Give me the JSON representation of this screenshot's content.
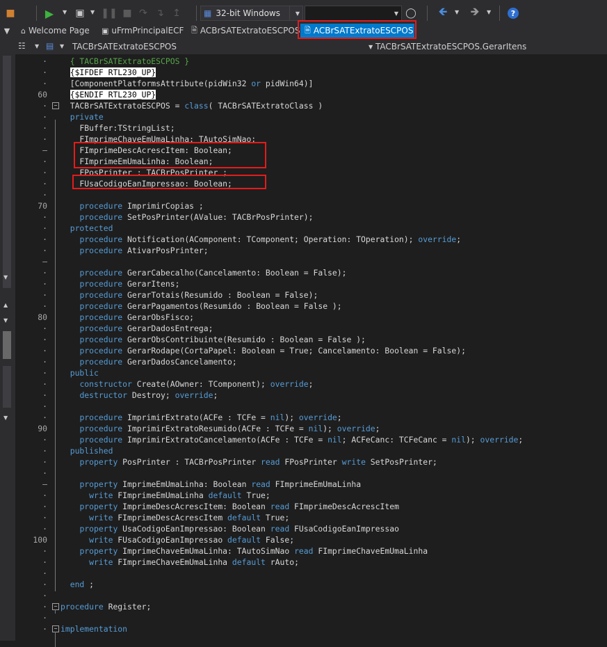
{
  "toolbar": {
    "platform_label": "32-bit Windows",
    "help_label": "?"
  },
  "tabs": [
    {
      "label": "Welcome Page"
    },
    {
      "label": "uFrmPrincipalECF"
    },
    {
      "label": "ACBrSATExtratoESCPOS"
    },
    {
      "label": "ACBrSATExtratoESCPOS"
    }
  ],
  "navbar": {
    "class_combo": "TACBrSATExtratoESCPOS",
    "method_combo": "TACBrSATExtratoESCPOS.GerarItens"
  },
  "editor": {
    "lines": [
      {
        "n": "·",
        "fold": "",
        "tokens": [
          {
            "t": "  { TACBrSATExtratoESCPOS }",
            "c": "cm"
          }
        ]
      },
      {
        "n": "·",
        "fold": "",
        "tokens": [
          {
            "t": "  "
          },
          {
            "t": "{$IFDEF RTL230_UP}",
            "c": "dir"
          }
        ]
      },
      {
        "n": "·",
        "fold": "",
        "tokens": [
          {
            "t": "  [ComponentPlatformsAttribute(pidWin32 "
          },
          {
            "t": "or",
            "c": "kw"
          },
          {
            "t": " pidWin64)]"
          }
        ]
      },
      {
        "n": "60",
        "fold": "",
        "tokens": [
          {
            "t": "  "
          },
          {
            "t": "{$ENDIF RTL230_UP}",
            "c": "dir"
          }
        ]
      },
      {
        "n": "·",
        "fold": "box",
        "tokens": [
          {
            "t": "  TACBrSATExtratoESCPOS = "
          },
          {
            "t": "class",
            "c": "kw"
          },
          {
            "t": "( TACBrSATExtratoClass )"
          }
        ]
      },
      {
        "n": "·",
        "fold": "",
        "tokens": [
          {
            "t": "  "
          },
          {
            "t": "private",
            "c": "kw"
          }
        ]
      },
      {
        "n": "·",
        "fold": "",
        "tokens": [
          {
            "t": "    FBuffer:TStringList;"
          }
        ]
      },
      {
        "n": "·",
        "fold": "",
        "tokens": [
          {
            "t": "    FImprimeChaveEmUmaLinha: TAutoSimNao;"
          }
        ]
      },
      {
        "n": "–",
        "fold": "",
        "tokens": [
          {
            "t": "    FImprimeDescAcrescItem: Boolean;"
          }
        ]
      },
      {
        "n": "·",
        "fold": "",
        "tokens": [
          {
            "t": "    FImprimeEmUmaLinha: Boolean;"
          }
        ]
      },
      {
        "n": "·",
        "fold": "",
        "tokens": [
          {
            "t": "    FPosPrinter : TACBrPosPrinter ;"
          }
        ]
      },
      {
        "n": "·",
        "fold": "",
        "tokens": [
          {
            "t": "    FUsaCodigoEanImpressao: Boolean;"
          }
        ]
      },
      {
        "n": "·",
        "fold": "",
        "tokens": []
      },
      {
        "n": "70",
        "fold": "",
        "tokens": [
          {
            "t": "    "
          },
          {
            "t": "procedure",
            "c": "kw"
          },
          {
            "t": " ImprimirCopias ;"
          }
        ]
      },
      {
        "n": "·",
        "fold": "",
        "tokens": [
          {
            "t": "    "
          },
          {
            "t": "procedure",
            "c": "kw"
          },
          {
            "t": " SetPosPrinter(AValue: TACBrPosPrinter);"
          }
        ]
      },
      {
        "n": "·",
        "fold": "",
        "tokens": [
          {
            "t": "  "
          },
          {
            "t": "protected",
            "c": "kw"
          }
        ]
      },
      {
        "n": "·",
        "fold": "",
        "tokens": [
          {
            "t": "    "
          },
          {
            "t": "procedure",
            "c": "kw"
          },
          {
            "t": " Notification(AComponent: TComponent; Operation: TOperation); "
          },
          {
            "t": "override",
            "c": "kw"
          },
          {
            "t": ";"
          }
        ]
      },
      {
        "n": "·",
        "fold": "",
        "tokens": [
          {
            "t": "    "
          },
          {
            "t": "procedure",
            "c": "kw"
          },
          {
            "t": " AtivarPosPrinter;"
          }
        ]
      },
      {
        "n": "–",
        "fold": "",
        "tokens": []
      },
      {
        "n": "·",
        "fold": "",
        "tokens": [
          {
            "t": "    "
          },
          {
            "t": "procedure",
            "c": "kw"
          },
          {
            "t": " GerarCabecalho(Cancelamento: Boolean = False);"
          }
        ]
      },
      {
        "n": "·",
        "fold": "",
        "tokens": [
          {
            "t": "    "
          },
          {
            "t": "procedure",
            "c": "kw"
          },
          {
            "t": " GerarItens;"
          }
        ]
      },
      {
        "n": "·",
        "fold": "",
        "tokens": [
          {
            "t": "    "
          },
          {
            "t": "procedure",
            "c": "kw"
          },
          {
            "t": " GerarTotais(Resumido : Boolean = False);"
          }
        ]
      },
      {
        "n": "·",
        "fold": "",
        "tokens": [
          {
            "t": "    "
          },
          {
            "t": "procedure",
            "c": "kw"
          },
          {
            "t": " GerarPagamentos(Resumido : Boolean = False );"
          }
        ]
      },
      {
        "n": "80",
        "fold": "",
        "tokens": [
          {
            "t": "    "
          },
          {
            "t": "procedure",
            "c": "kw"
          },
          {
            "t": " GerarObsFisco;"
          }
        ]
      },
      {
        "n": "·",
        "fold": "",
        "tokens": [
          {
            "t": "    "
          },
          {
            "t": "procedure",
            "c": "kw"
          },
          {
            "t": " GerarDadosEntrega;"
          }
        ]
      },
      {
        "n": "·",
        "fold": "",
        "tokens": [
          {
            "t": "    "
          },
          {
            "t": "procedure",
            "c": "kw"
          },
          {
            "t": " GerarObsContribuinte(Resumido : Boolean = False );"
          }
        ]
      },
      {
        "n": "·",
        "fold": "",
        "tokens": [
          {
            "t": "    "
          },
          {
            "t": "procedure",
            "c": "kw"
          },
          {
            "t": " GerarRodape(CortaPapel: Boolean = True; Cancelamento: Boolean = False);"
          }
        ]
      },
      {
        "n": "·",
        "fold": "",
        "tokens": [
          {
            "t": "    "
          },
          {
            "t": "procedure",
            "c": "kw"
          },
          {
            "t": " GerarDadosCancelamento;"
          }
        ]
      },
      {
        "n": "·",
        "fold": "",
        "tokens": [
          {
            "t": "  "
          },
          {
            "t": "public",
            "c": "kw"
          }
        ]
      },
      {
        "n": "·",
        "fold": "",
        "tokens": [
          {
            "t": "    "
          },
          {
            "t": "constructor",
            "c": "kw"
          },
          {
            "t": " Create(AOwner: TComponent); "
          },
          {
            "t": "override",
            "c": "kw"
          },
          {
            "t": ";"
          }
        ]
      },
      {
        "n": "·",
        "fold": "",
        "tokens": [
          {
            "t": "    "
          },
          {
            "t": "destructor",
            "c": "kw"
          },
          {
            "t": " Destroy; "
          },
          {
            "t": "override",
            "c": "kw"
          },
          {
            "t": ";"
          }
        ]
      },
      {
        "n": "·",
        "fold": "",
        "tokens": []
      },
      {
        "n": "·",
        "fold": "",
        "tokens": [
          {
            "t": "    "
          },
          {
            "t": "procedure",
            "c": "kw"
          },
          {
            "t": " ImprimirExtrato(ACFe : TCFe = "
          },
          {
            "t": "nil",
            "c": "kw"
          },
          {
            "t": "); "
          },
          {
            "t": "override",
            "c": "kw"
          },
          {
            "t": ";"
          }
        ]
      },
      {
        "n": "90",
        "fold": "",
        "tokens": [
          {
            "t": "    "
          },
          {
            "t": "procedure",
            "c": "kw"
          },
          {
            "t": " ImprimirExtratoResumido(ACFe : TCFe = "
          },
          {
            "t": "nil",
            "c": "kw"
          },
          {
            "t": "); "
          },
          {
            "t": "override",
            "c": "kw"
          },
          {
            "t": ";"
          }
        ]
      },
      {
        "n": "·",
        "fold": "",
        "tokens": [
          {
            "t": "    "
          },
          {
            "t": "procedure",
            "c": "kw"
          },
          {
            "t": " ImprimirExtratoCancelamento(ACFe : TCFe = "
          },
          {
            "t": "nil",
            "c": "kw"
          },
          {
            "t": "; ACFeCanc: TCFeCanc = "
          },
          {
            "t": "nil",
            "c": "kw"
          },
          {
            "t": "); "
          },
          {
            "t": "override",
            "c": "kw"
          },
          {
            "t": ";"
          }
        ]
      },
      {
        "n": "·",
        "fold": "",
        "tokens": [
          {
            "t": "  "
          },
          {
            "t": "published",
            "c": "kw"
          }
        ]
      },
      {
        "n": "·",
        "fold": "",
        "tokens": [
          {
            "t": "    "
          },
          {
            "t": "property",
            "c": "kw"
          },
          {
            "t": " PosPrinter : TACBrPosPrinter "
          },
          {
            "t": "read",
            "c": "kw"
          },
          {
            "t": " FPosPrinter "
          },
          {
            "t": "write",
            "c": "kw"
          },
          {
            "t": " SetPosPrinter;"
          }
        ]
      },
      {
        "n": "·",
        "fold": "",
        "tokens": []
      },
      {
        "n": "–",
        "fold": "",
        "tokens": [
          {
            "t": "    "
          },
          {
            "t": "property",
            "c": "kw"
          },
          {
            "t": " ImprimeEmUmaLinha: Boolean "
          },
          {
            "t": "read",
            "c": "kw"
          },
          {
            "t": " FImprimeEmUmaLinha"
          }
        ]
      },
      {
        "n": "·",
        "fold": "",
        "tokens": [
          {
            "t": "      "
          },
          {
            "t": "write",
            "c": "kw"
          },
          {
            "t": " FImprimeEmUmaLinha "
          },
          {
            "t": "default",
            "c": "kw"
          },
          {
            "t": " True;"
          }
        ]
      },
      {
        "n": "·",
        "fold": "",
        "tokens": [
          {
            "t": "    "
          },
          {
            "t": "property",
            "c": "kw"
          },
          {
            "t": " ImprimeDescAcrescItem: Boolean "
          },
          {
            "t": "read",
            "c": "kw"
          },
          {
            "t": " FImprimeDescAcrescItem"
          }
        ]
      },
      {
        "n": "·",
        "fold": "",
        "tokens": [
          {
            "t": "      "
          },
          {
            "t": "write",
            "c": "kw"
          },
          {
            "t": " FImprimeDescAcrescItem "
          },
          {
            "t": "default",
            "c": "kw"
          },
          {
            "t": " True;"
          }
        ]
      },
      {
        "n": "·",
        "fold": "",
        "tokens": [
          {
            "t": "    "
          },
          {
            "t": "property",
            "c": "kw"
          },
          {
            "t": " UsaCodigoEanImpressao: Boolean "
          },
          {
            "t": "read",
            "c": "kw"
          },
          {
            "t": " FUsaCodigoEanImpressao"
          }
        ]
      },
      {
        "n": "100",
        "fold": "",
        "tokens": [
          {
            "t": "      "
          },
          {
            "t": "write",
            "c": "kw"
          },
          {
            "t": " FUsaCodigoEanImpressao "
          },
          {
            "t": "default",
            "c": "kw"
          },
          {
            "t": " False;"
          }
        ]
      },
      {
        "n": "·",
        "fold": "",
        "tokens": [
          {
            "t": "    "
          },
          {
            "t": "property",
            "c": "kw"
          },
          {
            "t": " ImprimeChaveEmUmaLinha: TAutoSimNao "
          },
          {
            "t": "read",
            "c": "kw"
          },
          {
            "t": " FImprimeChaveEmUmaLinha"
          }
        ]
      },
      {
        "n": "·",
        "fold": "",
        "tokens": [
          {
            "t": "      "
          },
          {
            "t": "write",
            "c": "kw"
          },
          {
            "t": " FImprimeChaveEmUmaLinha "
          },
          {
            "t": "default",
            "c": "kw"
          },
          {
            "t": " rAuto;"
          }
        ]
      },
      {
        "n": "·",
        "fold": "",
        "tokens": []
      },
      {
        "n": "·",
        "fold": "",
        "tokens": [
          {
            "t": "  "
          },
          {
            "t": "end",
            "c": "kw"
          },
          {
            "t": " ;"
          }
        ]
      },
      {
        "n": "·",
        "fold": "",
        "tokens": []
      },
      {
        "n": "·",
        "fold": "box",
        "tokens": [
          {
            "t": "procedure",
            "c": "kw"
          },
          {
            "t": " Register;"
          }
        ]
      },
      {
        "n": "·",
        "fold": "",
        "tokens": []
      },
      {
        "n": "·",
        "fold": "box",
        "tokens": [
          {
            "t": "implementation",
            "c": "kw"
          }
        ]
      }
    ]
  },
  "colors": {
    "background": "#1e1e1e",
    "keyword": "#569cd6",
    "comment": "#57a64a",
    "highlight": "#e51b1b",
    "active_tab": "#007acc"
  }
}
